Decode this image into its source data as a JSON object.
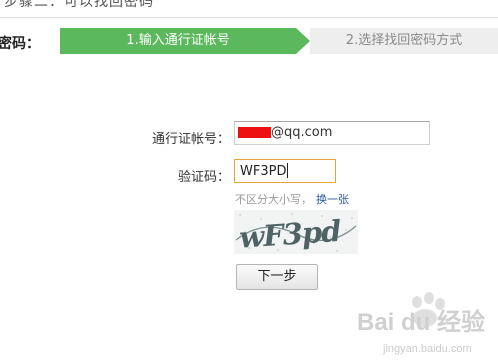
{
  "top_strip": {
    "text": "步骤二：可以找回密码"
  },
  "header": {
    "label": "密码："
  },
  "steps": [
    {
      "label": "1.输入通行证帐号",
      "active": true
    },
    {
      "label": "2.选择找回密码方式",
      "active": false
    }
  ],
  "form": {
    "account_label": "通行证帐号：",
    "account_value_suffix": "@qq.com",
    "redaction_color": "#ee1111",
    "captcha_label": "验证码：",
    "captcha_value": "WF3PD",
    "hint": "不区分大小写，",
    "change_link": "换一张",
    "captcha_image_text": "wF3pd",
    "next_button": "下一步"
  },
  "colors": {
    "step_active": "#5bb85d",
    "step_inactive": "#eeeeee",
    "link": "#2a5ba8",
    "focus_border": "#e8a33d"
  },
  "watermark": {
    "logo_text": "Bai du 经验",
    "url": "jingyan.baidu.com"
  }
}
